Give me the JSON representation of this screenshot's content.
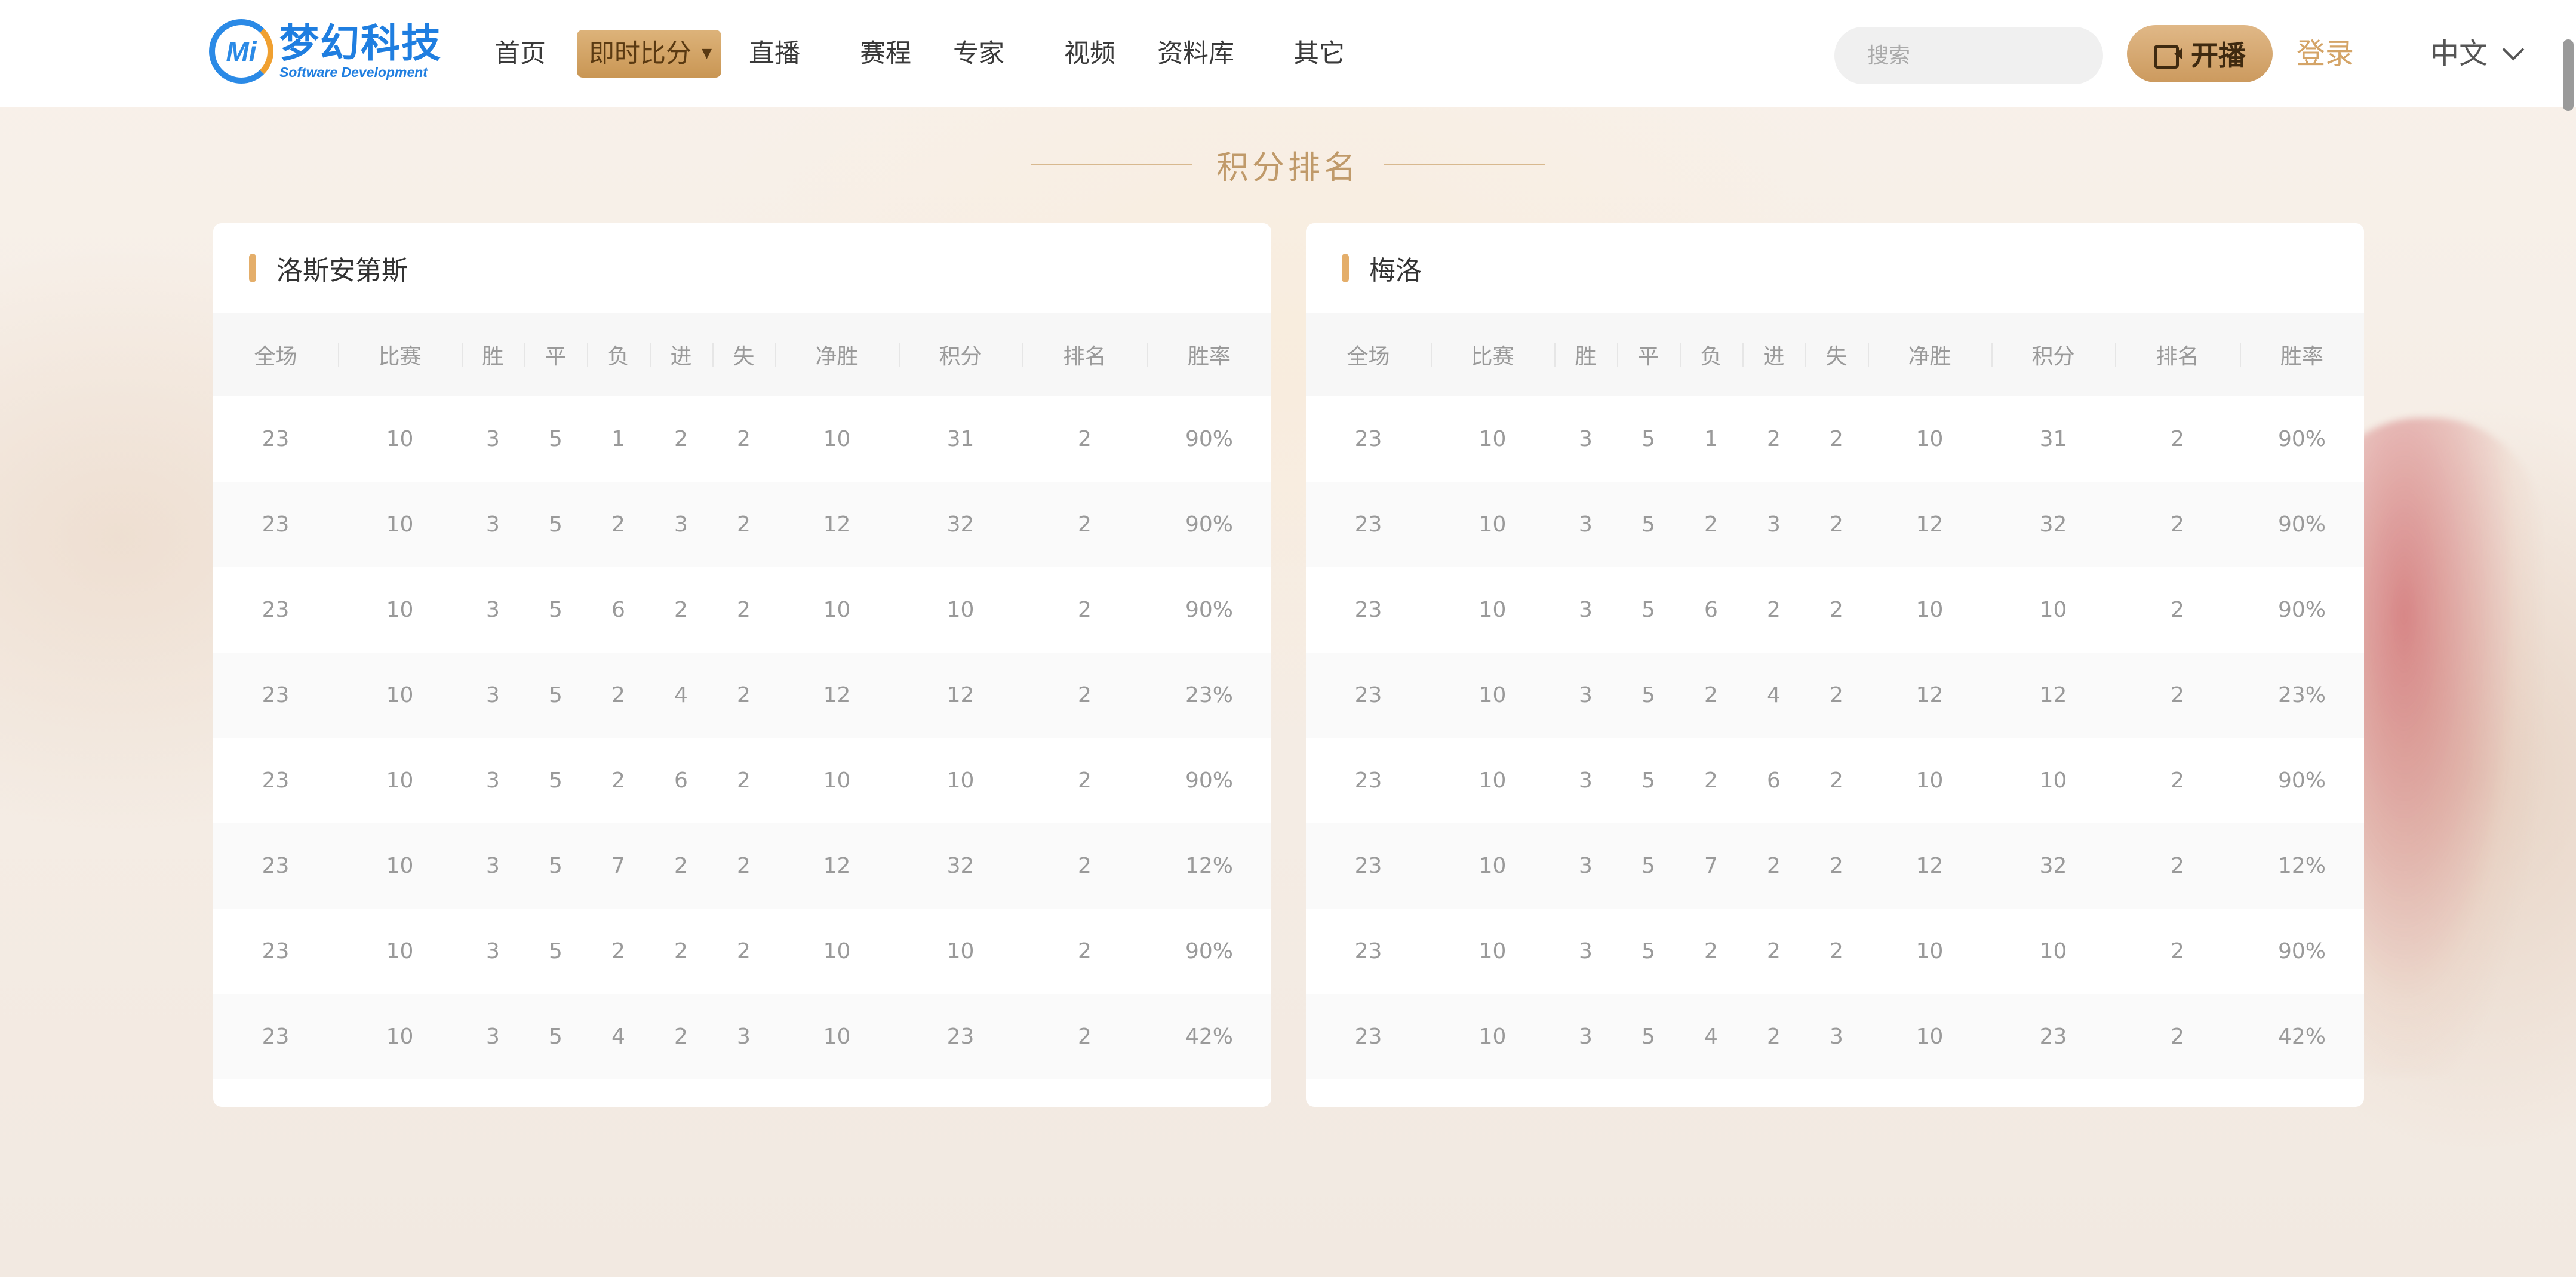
{
  "logo": {
    "mark": "Mi",
    "title": "梦幻科技",
    "subtitle": "Software Development"
  },
  "nav": {
    "items": [
      "首页",
      "即时比分",
      "直播",
      "赛程",
      "专家",
      "视频",
      "资料库",
      "其它"
    ],
    "active_index": 1
  },
  "search": {
    "placeholder": "搜索"
  },
  "live_button": {
    "label": "开播",
    "icon": "camera-icon"
  },
  "login": {
    "label": "登录"
  },
  "language": {
    "label": "中文"
  },
  "section": {
    "title": "积分排名"
  },
  "colors": {
    "accent": "#d4a467",
    "active_nav": "#c99654",
    "bar": "#e4ae6a"
  },
  "columns": [
    "全场",
    "比赛",
    "胜",
    "平",
    "负",
    "进",
    "失",
    "净胜",
    "积分",
    "排名",
    "胜率"
  ],
  "tables": [
    {
      "team": "洛斯安第斯",
      "rows": [
        [
          "23",
          "10",
          "3",
          "5",
          "1",
          "2",
          "2",
          "10",
          "31",
          "2",
          "90%"
        ],
        [
          "23",
          "10",
          "3",
          "5",
          "2",
          "3",
          "2",
          "12",
          "32",
          "2",
          "90%"
        ],
        [
          "23",
          "10",
          "3",
          "5",
          "6",
          "2",
          "2",
          "10",
          "10",
          "2",
          "90%"
        ],
        [
          "23",
          "10",
          "3",
          "5",
          "2",
          "4",
          "2",
          "12",
          "12",
          "2",
          "23%"
        ],
        [
          "23",
          "10",
          "3",
          "5",
          "2",
          "6",
          "2",
          "10",
          "10",
          "2",
          "90%"
        ],
        [
          "23",
          "10",
          "3",
          "5",
          "7",
          "2",
          "2",
          "12",
          "32",
          "2",
          "12%"
        ],
        [
          "23",
          "10",
          "3",
          "5",
          "2",
          "2",
          "2",
          "10",
          "10",
          "2",
          "90%"
        ],
        [
          "23",
          "10",
          "3",
          "5",
          "4",
          "2",
          "3",
          "10",
          "23",
          "2",
          "42%"
        ]
      ]
    },
    {
      "team": "梅洛",
      "rows": [
        [
          "23",
          "10",
          "3",
          "5",
          "1",
          "2",
          "2",
          "10",
          "31",
          "2",
          "90%"
        ],
        [
          "23",
          "10",
          "3",
          "5",
          "2",
          "3",
          "2",
          "12",
          "32",
          "2",
          "90%"
        ],
        [
          "23",
          "10",
          "3",
          "5",
          "6",
          "2",
          "2",
          "10",
          "10",
          "2",
          "90%"
        ],
        [
          "23",
          "10",
          "3",
          "5",
          "2",
          "4",
          "2",
          "12",
          "12",
          "2",
          "23%"
        ],
        [
          "23",
          "10",
          "3",
          "5",
          "2",
          "6",
          "2",
          "10",
          "10",
          "2",
          "90%"
        ],
        [
          "23",
          "10",
          "3",
          "5",
          "7",
          "2",
          "2",
          "12",
          "32",
          "2",
          "12%"
        ],
        [
          "23",
          "10",
          "3",
          "5",
          "2",
          "2",
          "2",
          "10",
          "10",
          "2",
          "90%"
        ],
        [
          "23",
          "10",
          "3",
          "5",
          "4",
          "2",
          "3",
          "10",
          "23",
          "2",
          "42%"
        ]
      ]
    }
  ]
}
